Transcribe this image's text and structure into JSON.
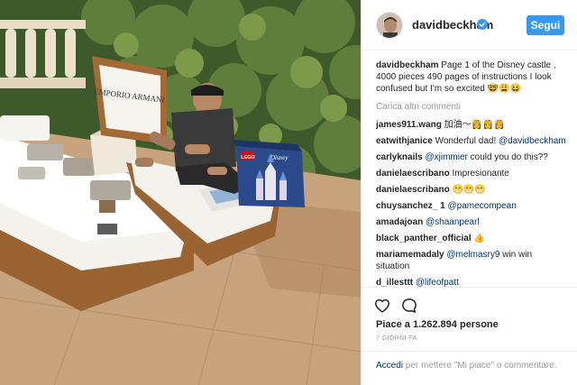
{
  "post": {
    "username": "davidbeckham",
    "follow_label": "Segui",
    "caption_username": "davidbeckham",
    "caption_text": " Page 1 of the Disney castle , 4000 pieces 490 pages of instructions I look confused but I'm so excited 🤓😩😆",
    "load_more": "Carica altri commenti",
    "comments": [
      {
        "user": "james911.wang",
        "text": " 加油～👸👸👸",
        "mention": ""
      },
      {
        "user": "eatwithjanice",
        "text": " Wonderful dad! ",
        "mention": "@davidbeckham"
      },
      {
        "user": "carlyknails",
        "text": " could you do this??",
        "mention": "@xjimmier",
        "mention_first": true
      },
      {
        "user": "danielaescribano",
        "text": " Impresionante",
        "mention": ""
      },
      {
        "user": "danielaescribano",
        "text": " 😁😁😁",
        "mention": ""
      },
      {
        "user": "chuysanchez_ 1",
        "text": "",
        "mention": "@pamecompean"
      },
      {
        "user": "amadajoan",
        "text": "",
        "mention": "@shaanpearl"
      },
      {
        "user": "black_panther_official",
        "text": " 👍",
        "mention": ""
      },
      {
        "user": "mariamemadaly",
        "text": " win win situation",
        "mention": "@melmasry9"
      },
      {
        "user": "d_illesttt",
        "text": "",
        "mention": "@lifeofpatt"
      }
    ],
    "likes": "Piace a 1.262.894 persone",
    "time": "7 GIORNI FA",
    "login_link": "Accedi",
    "login_text": " per mettere \"Mi piace\" o commentare.",
    "photo_texts": {
      "cushion_brand": "EMPORIO ARMANI",
      "box_logo": "LEGO",
      "box_brand": "Disney"
    }
  },
  "colors": {
    "accent": "#3897f0",
    "link": "#003569",
    "muted": "#999999",
    "border": "#efefef",
    "verified": "#3897f0"
  },
  "icons": {
    "like": "heart-outline-icon",
    "comment": "comment-bubble-icon",
    "verified": "verified-badge-icon"
  }
}
